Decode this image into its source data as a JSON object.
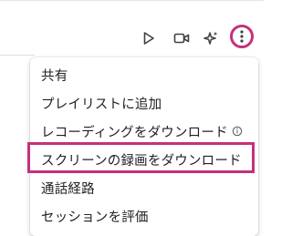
{
  "toolbar": {
    "icons": [
      "play-icon",
      "video-camera-icon",
      "sparkle-icon",
      "more-vert-icon"
    ]
  },
  "menu": {
    "items": [
      {
        "label": "共有"
      },
      {
        "label": "プレイリストに追加"
      },
      {
        "label": "レコーディングをダウンロード"
      },
      {
        "label": "スクリーンの録画をダウンロード"
      },
      {
        "label": "通話経路"
      },
      {
        "label": "セッションを評価"
      }
    ]
  },
  "colors": {
    "highlight": "#c6307a",
    "icon": "#3c4043",
    "text": "#202124"
  }
}
